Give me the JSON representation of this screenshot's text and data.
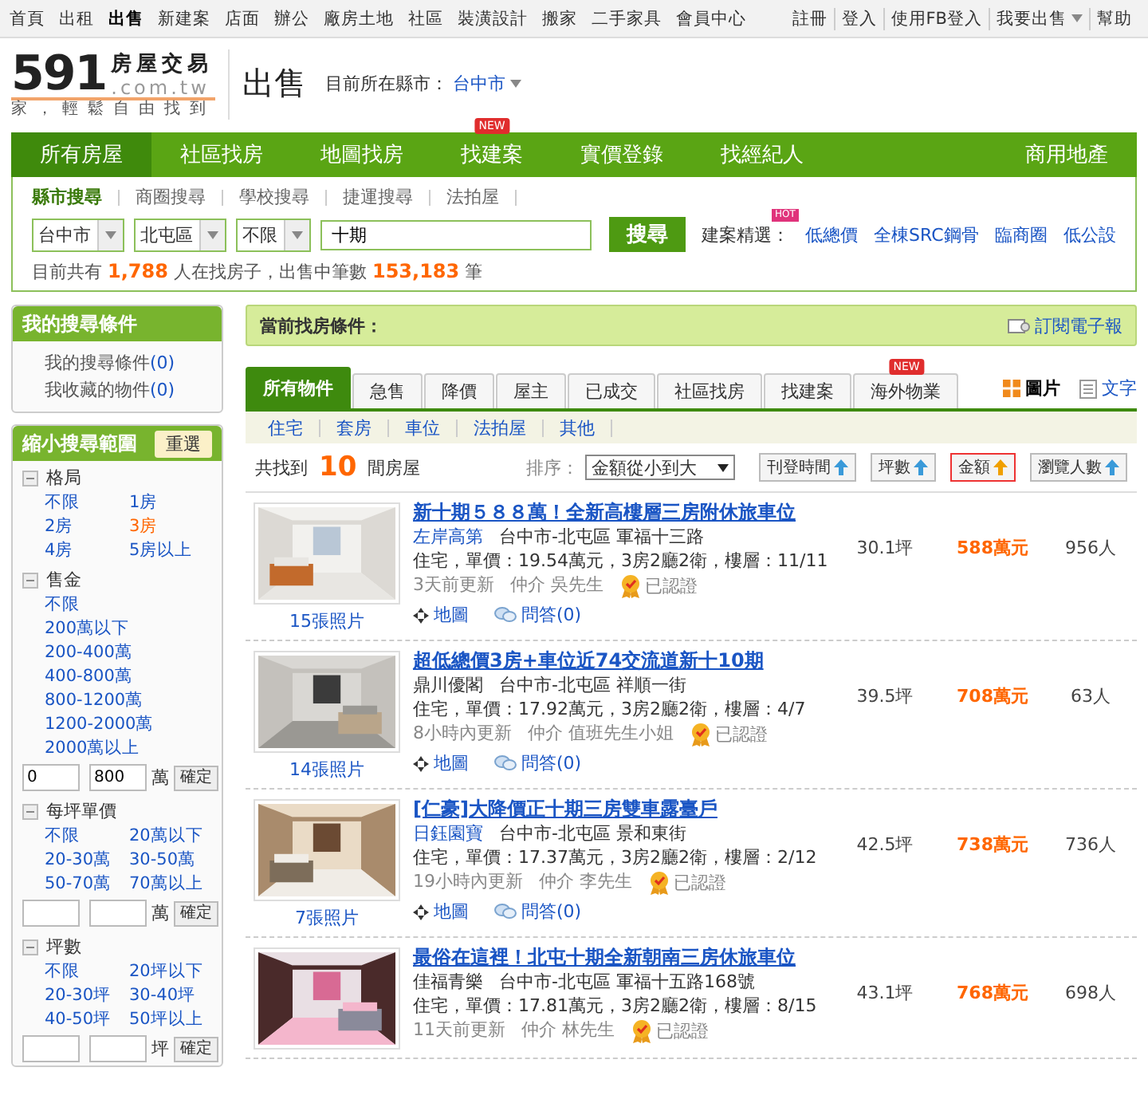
{
  "top_nav": {
    "items": [
      {
        "label": "首頁",
        "selected": false
      },
      {
        "label": "出租",
        "selected": false
      },
      {
        "label": "出售",
        "selected": true
      },
      {
        "label": "新建案",
        "selected": false
      },
      {
        "label": "店面",
        "selected": false
      },
      {
        "label": "辦公",
        "selected": false
      },
      {
        "label": "廠房土地",
        "selected": false
      },
      {
        "label": "社區",
        "selected": false
      },
      {
        "label": "裝潢設計",
        "selected": false
      },
      {
        "label": "搬家",
        "selected": false
      },
      {
        "label": "二手家具",
        "selected": false
      },
      {
        "label": "會員中心",
        "selected": false
      }
    ],
    "right_links": [
      {
        "label": "註冊",
        "has_menu": false
      },
      {
        "label": "登入",
        "has_menu": false
      },
      {
        "label": "使用FB登入",
        "has_menu": false
      },
      {
        "label": "我要出售",
        "has_menu": true
      },
      {
        "label": "幫助",
        "has_menu": false
      }
    ]
  },
  "header": {
    "logo": {
      "brand": "591",
      "name": "房屋交易",
      "domain": ".com.tw",
      "slogan": "家，輕鬆自由找到"
    },
    "section_title": "出售",
    "city_label": "目前所在縣市：",
    "city": "台中市"
  },
  "main_nav": {
    "items": [
      {
        "label": "所有房屋",
        "selected": true
      },
      {
        "label": "社區找房",
        "selected": false
      },
      {
        "label": "地圖找房",
        "selected": false
      },
      {
        "label": "找建案",
        "selected": false,
        "badge": "NEW"
      },
      {
        "label": "實價登錄",
        "selected": false
      },
      {
        "label": "找經紀人",
        "selected": false
      }
    ],
    "right_link": "商用地產"
  },
  "search": {
    "tabs": [
      {
        "label": "縣市搜尋",
        "selected": true
      },
      {
        "label": "商圈搜尋",
        "selected": false
      },
      {
        "label": "學校搜尋",
        "selected": false
      },
      {
        "label": "捷運搜尋",
        "selected": false
      },
      {
        "label": "法拍屋",
        "selected": false
      }
    ],
    "selects": [
      "台中市",
      "北屯區",
      "不限"
    ],
    "query": "十期",
    "button": "搜尋",
    "featured": {
      "label": "建案精選：",
      "badge": "HOT",
      "links": [
        "低總價",
        "全棟SRC鋼骨",
        "臨商圈",
        "低公設"
      ]
    },
    "stats": "目前共有 **1,788** 人在找房子，出售中筆數 **153,183** 筆"
  },
  "sidebar": {
    "my_search": {
      "title": "我的搜尋條件",
      "links": [
        {
          "label": "我的搜尋條件",
          "count": "(0)"
        },
        {
          "label": "我收藏的物件",
          "count": "(0)"
        }
      ]
    },
    "filters": {
      "title": "縮小搜尋範圍",
      "reset": "重選",
      "groups": [
        {
          "title": "格局",
          "expanded": true,
          "kind": "grid",
          "options": [
            {
              "label": "不限",
              "selected": false
            },
            {
              "label": "1房",
              "selected": false
            },
            {
              "label": "2房",
              "selected": false
            },
            {
              "label": "3房",
              "selected": true
            },
            {
              "label": "4房",
              "selected": false
            },
            {
              "label": "5房以上",
              "selected": false
            }
          ]
        },
        {
          "title": "售金",
          "expanded": true,
          "kind": "list",
          "options": [
            {
              "label": "不限",
              "selected": false
            },
            {
              "label": "200萬以下",
              "selected": false
            },
            {
              "label": "200-400萬",
              "selected": false
            },
            {
              "label": "400-800萬",
              "selected": false
            },
            {
              "label": "800-1200萬",
              "selected": false
            },
            {
              "label": "1200-2000萬",
              "selected": false
            },
            {
              "label": "2000萬以上",
              "selected": false
            }
          ],
          "range": {
            "min": "0",
            "max": "800",
            "unit": "萬",
            "button": "確定"
          }
        },
        {
          "title": "每坪單價",
          "expanded": true,
          "kind": "grid",
          "options": [
            {
              "label": "不限",
              "selected": false
            },
            {
              "label": "20萬以下",
              "selected": false
            },
            {
              "label": "20-30萬",
              "selected": false
            },
            {
              "label": "30-50萬",
              "selected": false
            },
            {
              "label": "50-70萬",
              "selected": false
            },
            {
              "label": "70萬以上",
              "selected": false
            }
          ],
          "range": {
            "unit": "萬",
            "button": "確定"
          }
        },
        {
          "title": "坪數",
          "expanded": true,
          "kind": "grid",
          "options": [
            {
              "label": "不限",
              "selected": false
            },
            {
              "label": "20坪以下",
              "selected": false
            },
            {
              "label": "20-30坪",
              "selected": false
            },
            {
              "label": "30-40坪",
              "selected": false
            },
            {
              "label": "40-50坪",
              "selected": false
            },
            {
              "label": "50坪以上",
              "selected": false
            }
          ],
          "range": {
            "unit": "坪",
            "button": "確定"
          }
        }
      ]
    }
  },
  "conditions": {
    "label": "當前找房條件：",
    "subscribe": "訂閱電子報"
  },
  "tabs": [
    {
      "label": "所有物件",
      "selected": true
    },
    {
      "label": "急售",
      "selected": false
    },
    {
      "label": "降價",
      "selected": false
    },
    {
      "label": "屋主",
      "selected": false
    },
    {
      "label": "已成交",
      "selected": false
    },
    {
      "label": "社區找房",
      "selected": false
    },
    {
      "label": "找建案",
      "selected": false
    },
    {
      "label": "海外物業",
      "selected": false,
      "badge": "NEW"
    }
  ],
  "view_modes": [
    {
      "label": "圖片",
      "kind": "grid",
      "selected": true
    },
    {
      "label": "文字",
      "kind": "list",
      "selected": false
    }
  ],
  "categories": [
    "住宅",
    "套房",
    "車位",
    "法拍屋",
    "其他"
  ],
  "results": {
    "prefix": "共找到",
    "count": "10",
    "suffix": "間房屋",
    "sort_label": "排序：",
    "sort_value": "金額從小到大",
    "sort_buttons": [
      {
        "label": "刊登時間",
        "selected": false
      },
      {
        "label": "坪數",
        "selected": false
      },
      {
        "label": "金額",
        "selected": true
      },
      {
        "label": "瀏覽人數",
        "selected": false
      }
    ]
  },
  "listings": [
    {
      "title": "新十期５８８萬！全新高樓層三房附休旅車位",
      "community": "左岸高第",
      "community_link": true,
      "address": "台中市-北屯區 軍福十三路",
      "details": "住宅，單價：19.54萬元，3房2廳2衛，樓層：11/11",
      "updated": "3天前更新",
      "agent": "仲介 吳先生",
      "verified": "已認證",
      "photos": "15張照片",
      "map": "地圖",
      "qa": "問答(0)",
      "area": "30.1坪",
      "price": "588萬元",
      "views": "956人"
    },
    {
      "title": "超低總價3房+車位近74交流道新十10期",
      "community": "鼎川優閣",
      "community_link": false,
      "address": "台中市-北屯區 祥順一街",
      "details": "住宅，單價：17.92萬元，3房2廳2衛，樓層：4/7",
      "updated": "8小時內更新",
      "agent": "仲介 值班先生小姐",
      "verified": "已認證",
      "photos": "14張照片",
      "map": "地圖",
      "qa": "問答(0)",
      "area": "39.5坪",
      "price": "708萬元",
      "views": "63人"
    },
    {
      "title": "[仁豪]大降價正十期三房雙車露臺戶",
      "community": "日鈺園寶",
      "community_link": true,
      "address": "台中市-北屯區 景和東街",
      "details": "住宅，單價：17.37萬元，3房2廳2衛，樓層：2/12",
      "updated": "19小時內更新",
      "agent": "仲介 李先生",
      "verified": "已認證",
      "photos": "7張照片",
      "map": "地圖",
      "qa": "問答(0)",
      "area": "42.5坪",
      "price": "738萬元",
      "views": "736人"
    },
    {
      "title": "最俗在這裡！北屯十期全新朝南三房休旅車位",
      "community": "佳福青樂",
      "community_link": false,
      "address": "台中市-北屯區 軍福十五路168號",
      "details": "住宅，單價：17.81萬元，3房2廳2衛，樓層：8/15",
      "updated": "11天前更新",
      "agent": "仲介 林先生",
      "verified": "已認證",
      "area": "43.1坪",
      "price": "768萬元",
      "views": "698人"
    }
  ]
}
